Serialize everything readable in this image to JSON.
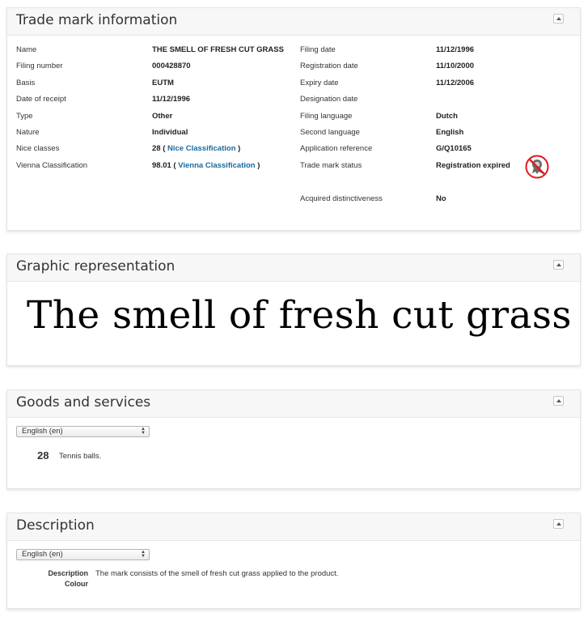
{
  "info": {
    "title": "Trade mark information",
    "left": [
      {
        "label": "Name",
        "value": "THE SMELL OF FRESH CUT GRASS"
      },
      {
        "label": "Filing number",
        "value": "000428870"
      },
      {
        "label": "Basis",
        "value": "EUTM"
      },
      {
        "label": "Date of receipt",
        "value": "11/12/1996"
      },
      {
        "label": "Type",
        "value": "Other"
      },
      {
        "label": "Nature",
        "value": "Individual"
      },
      {
        "label": "Nice classes",
        "value_prefix": "28 (",
        "link": "Nice Classification",
        "value_suffix": ")"
      },
      {
        "label": "Vienna Classification",
        "value_prefix": "98.01 (",
        "link": "Vienna Classification",
        "value_suffix": ")"
      }
    ],
    "right": [
      {
        "label": "Filing date",
        "value": "11/12/1996"
      },
      {
        "label": "Registration date",
        "value": "11/10/2000"
      },
      {
        "label": "Expiry date",
        "value": "11/12/2006"
      },
      {
        "label": "Designation date",
        "value": ""
      },
      {
        "label": "Filing language",
        "value": "Dutch"
      },
      {
        "label": "Second language",
        "value": "English"
      },
      {
        "label": "Application reference",
        "value": "G/Q10165"
      },
      {
        "label": "Trade mark status",
        "value": "Registration expired"
      },
      {
        "label": "Acquired distinctiveness",
        "value": "No"
      }
    ],
    "status_icon": "expired-status-icon",
    "status_color": "#e0191e"
  },
  "graphic": {
    "title": "Graphic representation",
    "mark_text": "The smell of fresh cut grass"
  },
  "goods": {
    "title": "Goods and services",
    "language_select": "English (en)",
    "class_number": "28",
    "class_text": "Tennis balls."
  },
  "description": {
    "title": "Description",
    "language_select": "English (en)",
    "label_description": "Description",
    "label_colour": "Colour",
    "text": "The mark consists of the smell of fresh cut grass applied to the product."
  }
}
